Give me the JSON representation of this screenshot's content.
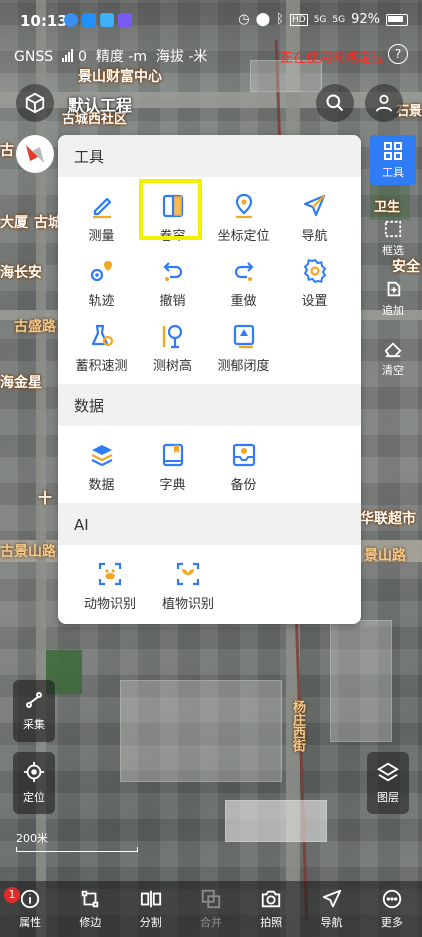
{
  "status_bar": {
    "time": "10:13",
    "battery": "92%",
    "signal1": "5G",
    "signal2": "5G",
    "hd": "HD"
  },
  "gnss_bar": {
    "gnss_label": "GNSS",
    "sat_count": "0",
    "accuracy": "精度 -m",
    "altitude": "海拔 -米",
    "network_warning": "正在使用网络定位",
    "help": "?"
  },
  "project": {
    "name": "默认工程"
  },
  "map_labels": {
    "north_label": "景山财富中心",
    "community": "古城西社区",
    "left1": "古",
    "left2": "大厦",
    "left3": "古城",
    "left4": "海长安",
    "road_left": "古盛路",
    "left5": "海金星",
    "left6": "十",
    "road_bottom_left": "古景山路",
    "road_bottom_right": "景山路",
    "right_shop": "华联超市",
    "right1": "安全",
    "right2": "卫生",
    "street_vertical": "杨庄西街",
    "right_top": "石景"
  },
  "right_toolbar": {
    "tools": "工具",
    "box_select": "框选",
    "append": "追加",
    "clear": "清空",
    "layers": "图层"
  },
  "left_toolbar": {
    "collect": "采集",
    "locate": "定位"
  },
  "scale": {
    "text": "200米"
  },
  "panel": {
    "sections": [
      {
        "title": "工具",
        "items": [
          {
            "label": "测量",
            "icon": "ruler-pencil-icon"
          },
          {
            "label": "卷帘",
            "icon": "swipe-book-icon"
          },
          {
            "label": "坐标定位",
            "icon": "map-pin-icon"
          },
          {
            "label": "导航",
            "icon": "navigation-arrow-icon"
          },
          {
            "label": "轨迹",
            "icon": "track-icon"
          },
          {
            "label": "撤销",
            "icon": "undo-icon"
          },
          {
            "label": "重做",
            "icon": "redo-icon"
          },
          {
            "label": "设置",
            "icon": "gear-icon"
          },
          {
            "label": "蓄积速测",
            "icon": "stock-measure-icon"
          },
          {
            "label": "测树高",
            "icon": "tree-height-icon"
          },
          {
            "label": "测郁闭度",
            "icon": "canopy-icon"
          }
        ]
      },
      {
        "title": "数据",
        "items": [
          {
            "label": "数据",
            "icon": "layers-stack-icon"
          },
          {
            "label": "字典",
            "icon": "dictionary-book-icon"
          },
          {
            "label": "备份",
            "icon": "backup-tray-icon"
          }
        ]
      },
      {
        "title": "AI",
        "items": [
          {
            "label": "动物识别",
            "icon": "animal-scan-icon"
          },
          {
            "label": "植物识别",
            "icon": "plant-scan-icon"
          }
        ]
      }
    ]
  },
  "bottom_nav": [
    {
      "label": "属性",
      "icon": "info-icon",
      "badge": "1",
      "enabled": true
    },
    {
      "label": "修边",
      "icon": "edge-edit-icon",
      "enabled": true
    },
    {
      "label": "分割",
      "icon": "split-icon",
      "enabled": true
    },
    {
      "label": "合并",
      "icon": "merge-icon",
      "enabled": false
    },
    {
      "label": "拍照",
      "icon": "camera-icon",
      "enabled": true
    },
    {
      "label": "导航",
      "icon": "navigate-icon",
      "enabled": true
    },
    {
      "label": "更多",
      "icon": "more-dots-icon",
      "enabled": true
    }
  ],
  "colors": {
    "accent": "#2f7cf5",
    "icon_orange": "#f5a623",
    "warning": "#ff2a1f",
    "highlight": "#f4f000"
  }
}
